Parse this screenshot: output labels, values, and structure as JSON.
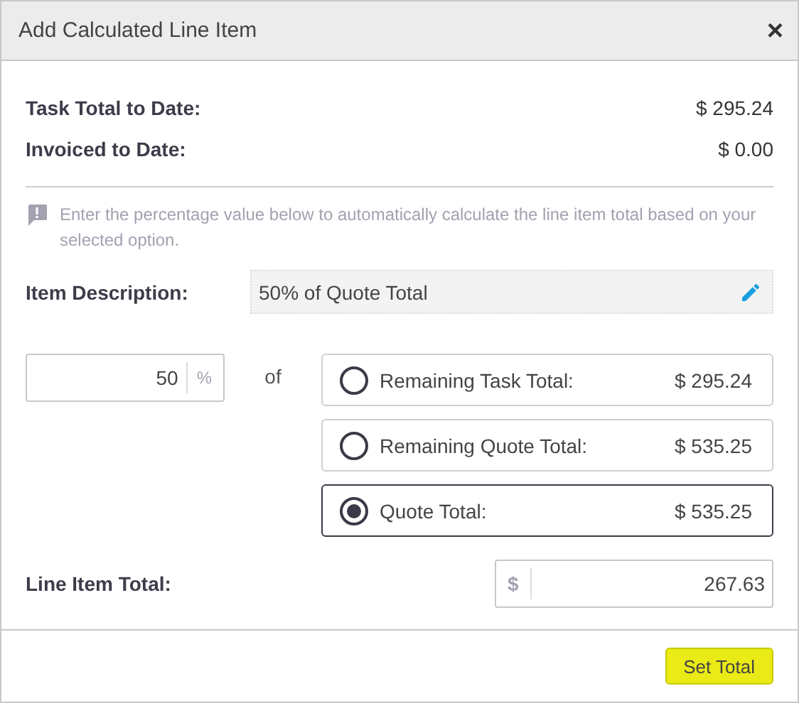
{
  "dialog": {
    "title": "Add Calculated Line Item",
    "close": "×"
  },
  "summary": [
    {
      "label": "Task Total to Date:",
      "value": "$ 295.24"
    },
    {
      "label": "Invoiced to Date:",
      "value": "$ 0.00"
    }
  ],
  "info": "Enter the percentage value below to automatically calculate the line item total based on your selected option.",
  "item_description": {
    "label": "Item Description:",
    "value": "50% of Quote Total"
  },
  "percent": {
    "value": "50",
    "unit": "%"
  },
  "of_label": "of",
  "options": [
    {
      "label": "Remaining Task Total:",
      "amount": "$ 295.24",
      "selected": false
    },
    {
      "label": "Remaining Quote Total:",
      "amount": "$ 535.25",
      "selected": false
    },
    {
      "label": "Quote Total:",
      "amount": "$ 535.25",
      "selected": true
    }
  ],
  "line_item_total": {
    "label": "Line Item Total:",
    "currency": "$",
    "value": "267.63"
  },
  "buttons": [
    {
      "label": "Set Total"
    }
  ]
}
